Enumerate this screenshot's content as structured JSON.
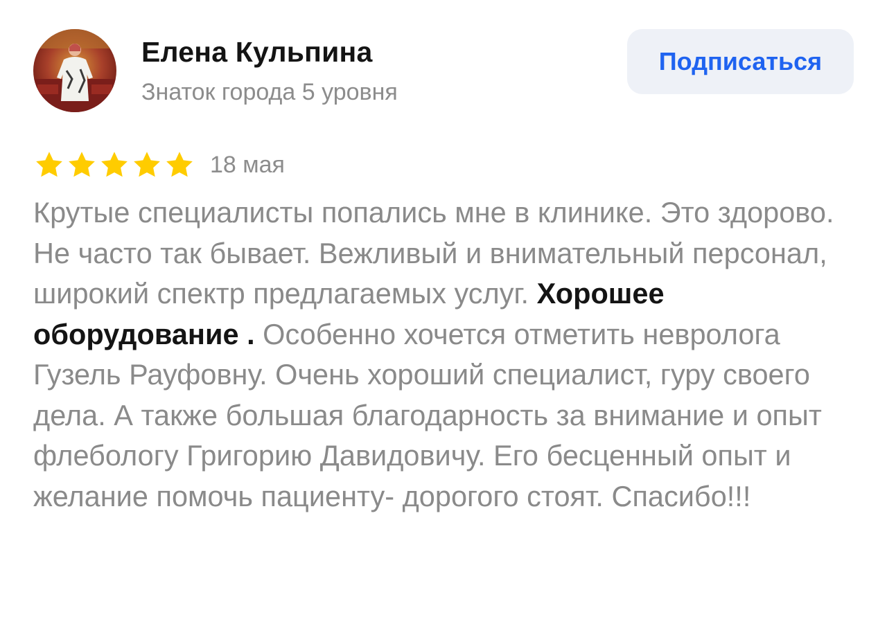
{
  "author": {
    "name": "Елена Кульпина",
    "level": "Знаток города 5 уровня"
  },
  "subscribe": {
    "label": "Подписаться"
  },
  "review": {
    "rating": 5,
    "rating_max": 5,
    "date": "18 мая",
    "text_part1": "Крутые специалисты попались мне в клинике. Это здорово. Не часто так бывает. Вежливый и внимательный персонал, широкий спектр предлагаемых услуг. ",
    "text_emphasis": "Хорошее оборудование .",
    "text_part2": " Особенно хочется отметить невролога Гузель Рауфовну. Очень хороший специалист, гуру своего дела. А также большая благодарность за внимание и опыт флебологу  Григорию Давидовичу. Его бесценный опыт и желание помочь пациенту- дорогого стоят. Спасибо!!!"
  },
  "colors": {
    "star": "#ffcc00",
    "button_text": "#1f63f0",
    "button_bg": "#eef1f7",
    "body_text": "#8a8a8a"
  }
}
